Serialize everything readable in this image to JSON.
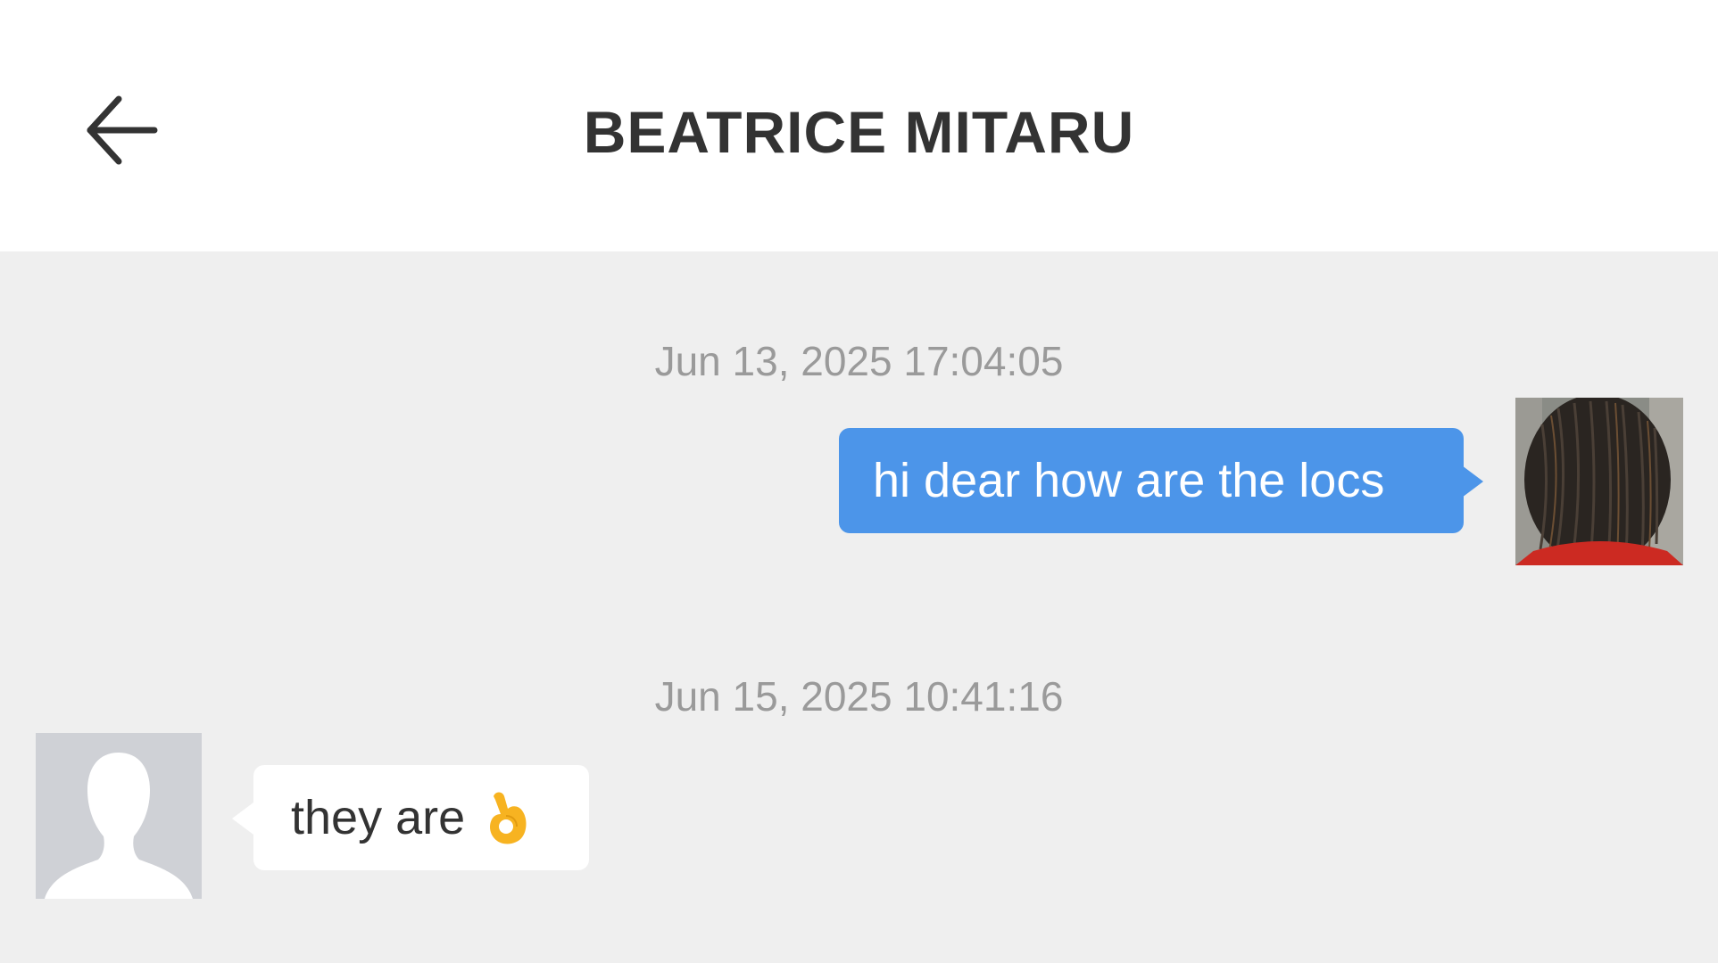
{
  "header": {
    "back_icon": "arrow-left-icon",
    "title": "BEATRICE MITARU"
  },
  "messages": [
    {
      "timestamp": "Jun 13, 2025 17:04:05",
      "direction": "outgoing",
      "text": "hi dear how are the locs",
      "avatar": "user-photo-avatar"
    },
    {
      "timestamp": "Jun 15, 2025 10:41:16",
      "direction": "incoming",
      "text": "they are",
      "emoji": "ok-hand-emoji-icon",
      "avatar": "default-person-avatar"
    }
  ],
  "colors": {
    "header_bg": "#ffffff",
    "chat_bg": "#efefef",
    "outgoing_bubble": "#4c95e9",
    "incoming_bubble": "#ffffff",
    "timestamp_text": "#9a9a9a",
    "title_text": "#333333"
  }
}
